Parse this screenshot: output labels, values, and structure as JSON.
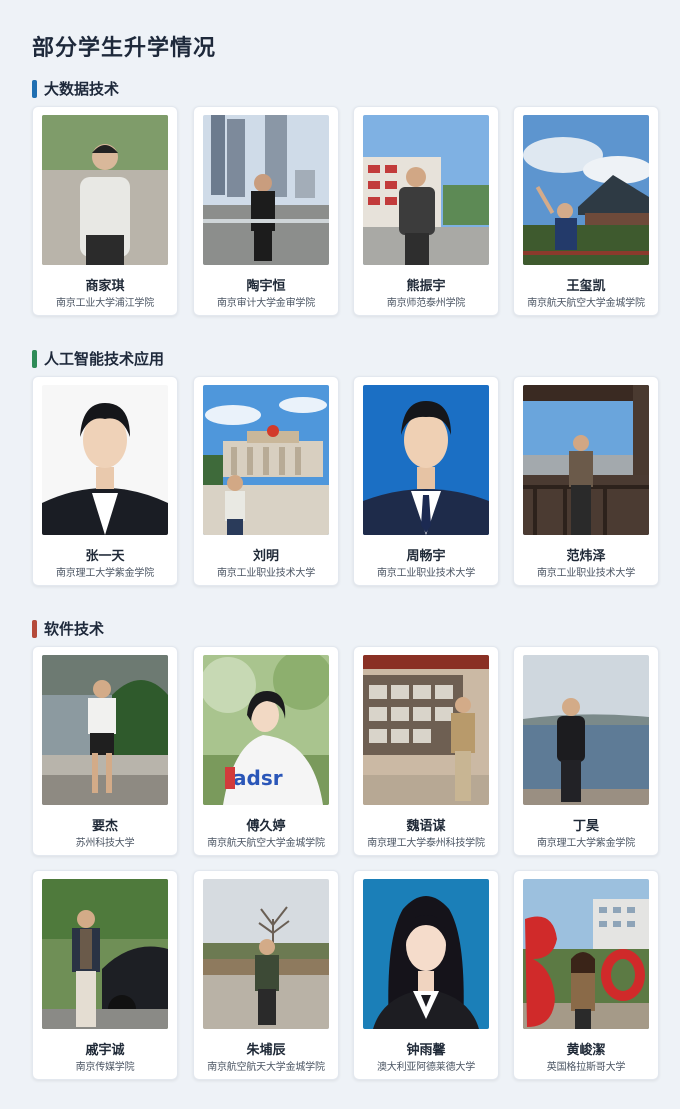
{
  "title": "部分学生升学情况",
  "sections": [
    {
      "name": "大数据技术",
      "color": "#1f6fb2",
      "students": [
        {
          "name": "商家琪",
          "school": "南京工业大学浦江学院"
        },
        {
          "name": "陶宇恒",
          "school": "南京审计大学金审学院"
        },
        {
          "name": "熊振宇",
          "school": "南京师范泰州学院"
        },
        {
          "name": "王玺凯",
          "school": "南京航天航空大学金城学院"
        }
      ]
    },
    {
      "name": "人工智能技术应用",
      "color": "#2e8b57",
      "students": [
        {
          "name": "张一天",
          "school": "南京理工大学紫金学院"
        },
        {
          "name": "刘明",
          "school": "南京工业职业技术大学"
        },
        {
          "name": "周畅宇",
          "school": "南京工业职业技术大学"
        },
        {
          "name": "范炜泽",
          "school": "南京工业职业技术大学"
        }
      ]
    },
    {
      "name": "软件技术",
      "color": "#b54a3a",
      "students": [
        {
          "name": "要杰",
          "school": "苏州科技大学"
        },
        {
          "name": "傅久婷",
          "school": "南京航天航空大学金城学院"
        },
        {
          "name": "魏语谋",
          "school": "南京理工大学泰州科技学院"
        },
        {
          "name": "丁昊",
          "school": "南京理工大学紫金学院"
        },
        {
          "name": "戚宇诚",
          "school": "南京传媒学院"
        },
        {
          "name": "朱埔辰",
          "school": "南京航空航天大学金城学院"
        },
        {
          "name": "钟雨馨",
          "school": "澳大利亚阿德莱德大学"
        },
        {
          "name": "黄峻潔",
          "school": "英国格拉斯哥大学"
        }
      ]
    }
  ]
}
